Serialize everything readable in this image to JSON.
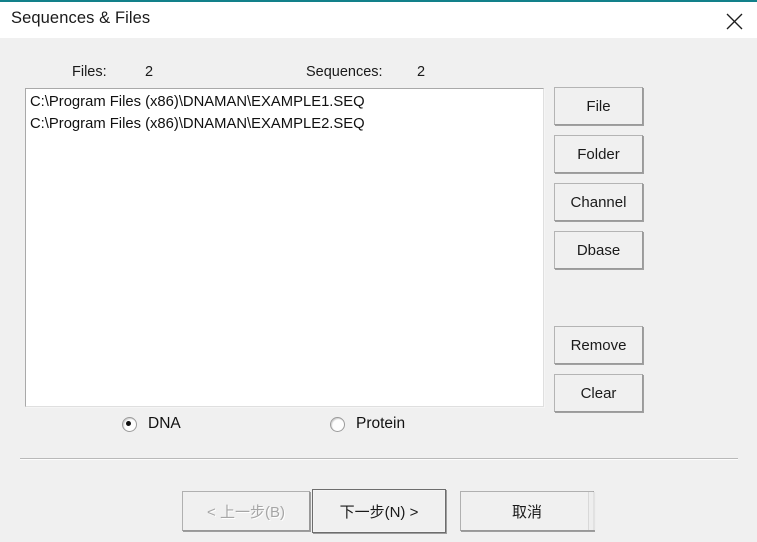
{
  "window": {
    "title": "Sequences & Files",
    "accent_color": "#12808a",
    "close_icon": "close-icon"
  },
  "counters": {
    "files_label": "Files:",
    "files_count": "2",
    "sequences_label": "Sequences:",
    "sequences_count": "2"
  },
  "file_list": {
    "items": [
      "C:\\Program Files (x86)\\DNAMAN\\EXAMPLE1.SEQ",
      "C:\\Program Files (x86)\\DNAMAN\\EXAMPLE2.SEQ"
    ]
  },
  "side_buttons": {
    "file": "File",
    "folder": "Folder",
    "channel": "Channel",
    "dbase": "Dbase",
    "remove": "Remove",
    "clear": "Clear"
  },
  "sequence_type": {
    "dna_label": "DNA",
    "protein_label": "Protein",
    "selected": "DNA"
  },
  "wizard_buttons": {
    "back": "< 上一步(B)",
    "next": "下一步(N) >",
    "cancel": "取消"
  }
}
